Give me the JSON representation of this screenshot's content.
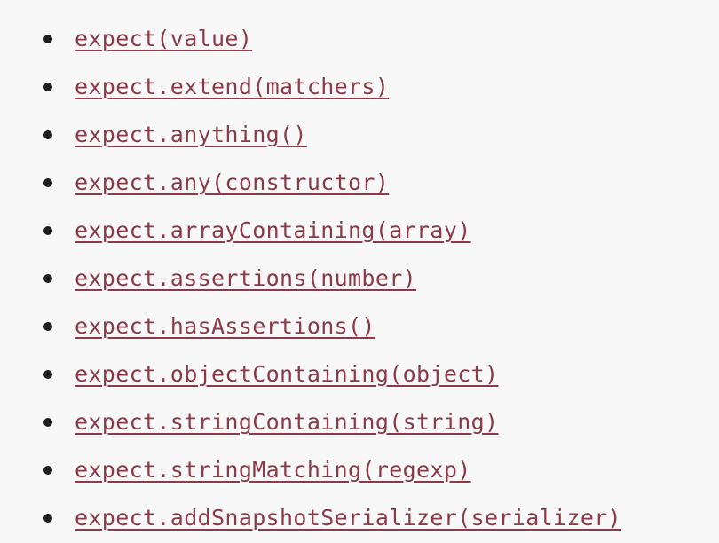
{
  "api_links": [
    "expect(value)",
    "expect.extend(matchers)",
    "expect.anything()",
    "expect.any(constructor)",
    "expect.arrayContaining(array)",
    "expect.assertions(number)",
    "expect.hasAssertions()",
    "expect.objectContaining(object)",
    "expect.stringContaining(string)",
    "expect.stringMatching(regexp)",
    "expect.addSnapshotSerializer(serializer)"
  ],
  "colors": {
    "background": "#f7f7f7",
    "link": "#8a3b49",
    "bullet": "#1f1f1f"
  }
}
